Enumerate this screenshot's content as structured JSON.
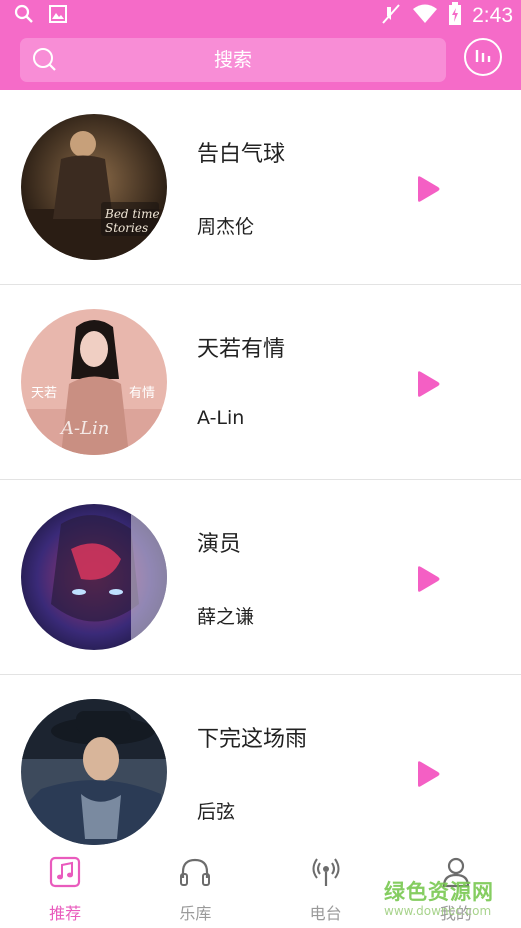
{
  "status_bar": {
    "time": "2:43",
    "icons": [
      "search-icon",
      "image-icon",
      "mute-icon",
      "wifi-icon",
      "battery-charging-icon"
    ]
  },
  "header": {
    "search_placeholder": "搜索",
    "equalizer_icon": "equalizer-icon"
  },
  "songs": [
    {
      "title": "告白气球",
      "artist": "周杰伦"
    },
    {
      "title": "天若有情",
      "artist": "A-Lin"
    },
    {
      "title": "演员",
      "artist": "薛之谦"
    },
    {
      "title": "下完这场雨",
      "artist": "后弦"
    }
  ],
  "tabs": [
    {
      "label": "推荐",
      "icon": "music-note-icon",
      "active": true
    },
    {
      "label": "乐库",
      "icon": "headphones-icon",
      "active": false
    },
    {
      "label": "电台",
      "icon": "radio-icon",
      "active": false
    },
    {
      "label": "我的",
      "icon": "user-icon",
      "active": false
    }
  ],
  "colors": {
    "accent": "#f56bc8",
    "search_box": "#f88dd6",
    "play": "#f45fc4",
    "active_tab": "#e95bbd",
    "inactive_tab": "#9a9a9a"
  },
  "watermark": {
    "text": "绿色资源网",
    "sub": "www.downcc.com"
  }
}
